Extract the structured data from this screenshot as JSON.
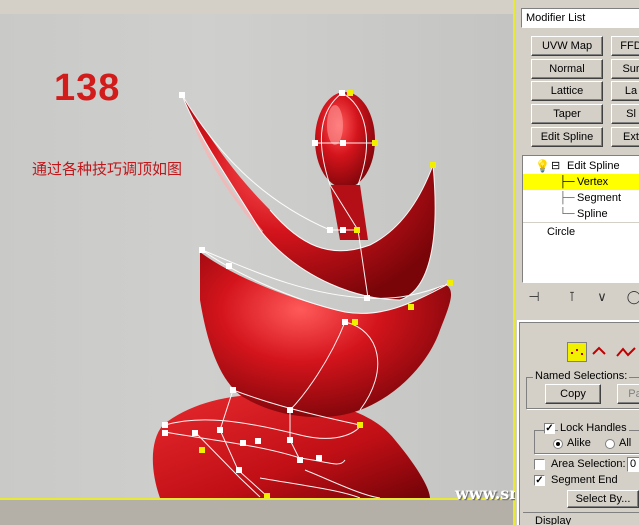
{
  "viewport": {
    "step_number": "138",
    "caption": "通过各种技巧调顶如图",
    "watermark": "www.snren.com"
  },
  "panel": {
    "modifier_list_label": "Modifier List",
    "modifier_buttons": [
      {
        "label": "UVW Map"
      },
      {
        "label": "FFD"
      },
      {
        "label": "Normal"
      },
      {
        "label": "Sur"
      },
      {
        "label": "Lattice"
      },
      {
        "label": "La"
      },
      {
        "label": "Taper"
      },
      {
        "label": "Sl"
      },
      {
        "label": "Edit Spline"
      },
      {
        "label": "Ext"
      }
    ],
    "stack": {
      "modifier": "Edit Spline",
      "sub_objects": [
        "Vertex",
        "Segment",
        "Spline"
      ],
      "selected": "Vertex",
      "base_object": "Circle"
    },
    "selection": {
      "named_selections_label": "Named Selections:",
      "copy_label": "Copy",
      "paste_label": "Pa",
      "lock_handles_label": "Lock Handles",
      "lock_handles_checked": true,
      "alike_label": "Alike",
      "alike_selected": true,
      "all_label": "All",
      "area_selection_label": "Area Selection:",
      "area_selection_value": "0",
      "area_selection_checked": false,
      "segment_end_label": "Segment End",
      "segment_end_checked": true,
      "select_by_label": "Select By...",
      "display_label": "Display"
    },
    "colors": {
      "selected_row": "#ffff00",
      "sculpture_red": "#d4141c",
      "caption_red": "#c0171b"
    }
  }
}
